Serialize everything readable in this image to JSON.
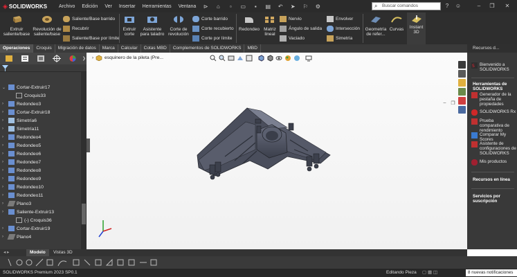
{
  "app": {
    "brand": "SOLIDWORKS",
    "brand_prefix": "3DS"
  },
  "menu": [
    "Archivo",
    "Edición",
    "Ver",
    "Insertar",
    "Herramientas",
    "Ventana"
  ],
  "search": {
    "placeholder": "Buscar comandos"
  },
  "ribbon": {
    "extruir_saliente": "Extruir saliente/base",
    "revolucion_saliente": "Revolución de saliente/base",
    "saliente_barrido": "Saliente/Base barrido",
    "recubrir": "Recubrir",
    "saliente_limite": "Saliente/Base por límite",
    "extruir_corte": "Extruir corte",
    "asistente_taladro": "Asistente para taladro",
    "corte_revolucion": "Corte de revolución",
    "corte_barrido": "Corte barrido",
    "corte_recubierto": "Corte recubierto",
    "corte_limite": "Corte por límite",
    "redondeo": "Redondeo",
    "matriz_lineal": "Matriz lineal",
    "nervio": "Nervio",
    "angulo_salida": "Ángulo de salida",
    "vaciado": "Vaciado",
    "envolver": "Envolver",
    "interseccion": "Intersección",
    "simetria": "Simetría",
    "geometria_ref": "Geometría de refer...",
    "curvas": "Curvas",
    "instant3d": "Instant 3D"
  },
  "tabs": [
    "Operaciones",
    "Croquis",
    "Migración de datos",
    "Marca",
    "Calcular",
    "Cotas MBD",
    "Complementos de SOLIDWORKS",
    "MBD"
  ],
  "active_tab": "Operaciones",
  "tree": [
    {
      "label": "Cortar-Extruir17",
      "expanded": true,
      "type": "cut",
      "indent": 0
    },
    {
      "label": "Croquis33",
      "type": "sketch",
      "indent": 1
    },
    {
      "label": "Redondeo3",
      "type": "fillet",
      "indent": 0
    },
    {
      "label": "Cortar-Extruir18",
      "type": "cut",
      "indent": 0
    },
    {
      "label": "Simetría6",
      "type": "mirror",
      "indent": 0
    },
    {
      "label": "Simetría11",
      "type": "mirror",
      "indent": 0
    },
    {
      "label": "Redondeo4",
      "type": "fillet",
      "indent": 0
    },
    {
      "label": "Redondeo5",
      "type": "fillet",
      "indent": 0
    },
    {
      "label": "Redondeo6",
      "type": "fillet",
      "indent": 0
    },
    {
      "label": "Redondeo7",
      "type": "fillet",
      "indent": 0
    },
    {
      "label": "Redondeo8",
      "type": "fillet",
      "indent": 0
    },
    {
      "label": "Redondeo9",
      "type": "fillet",
      "indent": 0
    },
    {
      "label": "Redondeo10",
      "type": "fillet",
      "indent": 0
    },
    {
      "label": "Redondeo11",
      "type": "fillet",
      "indent": 0
    },
    {
      "label": "Plano3",
      "type": "plane",
      "indent": 0
    },
    {
      "label": "Saliente-Extruir13",
      "type": "boss",
      "indent": 0
    },
    {
      "label": "(-) Croquis36",
      "type": "sketch",
      "indent": 1
    },
    {
      "label": "Cortar-Extruir19",
      "type": "cut",
      "indent": 0
    },
    {
      "label": "Plano4",
      "type": "plane",
      "indent": 0
    }
  ],
  "document": {
    "title": "esquinero de la pileta (Pre..."
  },
  "resources": {
    "header": "Recursos d...",
    "welcome": "Bienvenido a SOLIDWORKS",
    "tools_section": "Herramientas de SOLIDWORKS",
    "tools": [
      "Generador de la pestaña de propiedades",
      "SOLIDWORKS Rx",
      "Prueba comparativa de rendimiento",
      "Comparar My Scores",
      "Asistente de configuraciones de SOLIDWORKS",
      "Mis productos"
    ],
    "online_section": "Recursos en línea",
    "subscription_section": "Servicios por suscripción"
  },
  "bottom_tabs": [
    "Modelo",
    "Vistas 3D"
  ],
  "status": {
    "version": "SOLIDWORKS Premium 2023 SP0.1",
    "mode": "Editando Pieza",
    "notifications": "8 nuevas notificaciones"
  },
  "colors": {
    "accent": "#cc2233",
    "ribbon_bg": "#2e2e2e",
    "panel_bg": "#3b3b3b",
    "model": "#4a4e5c"
  }
}
